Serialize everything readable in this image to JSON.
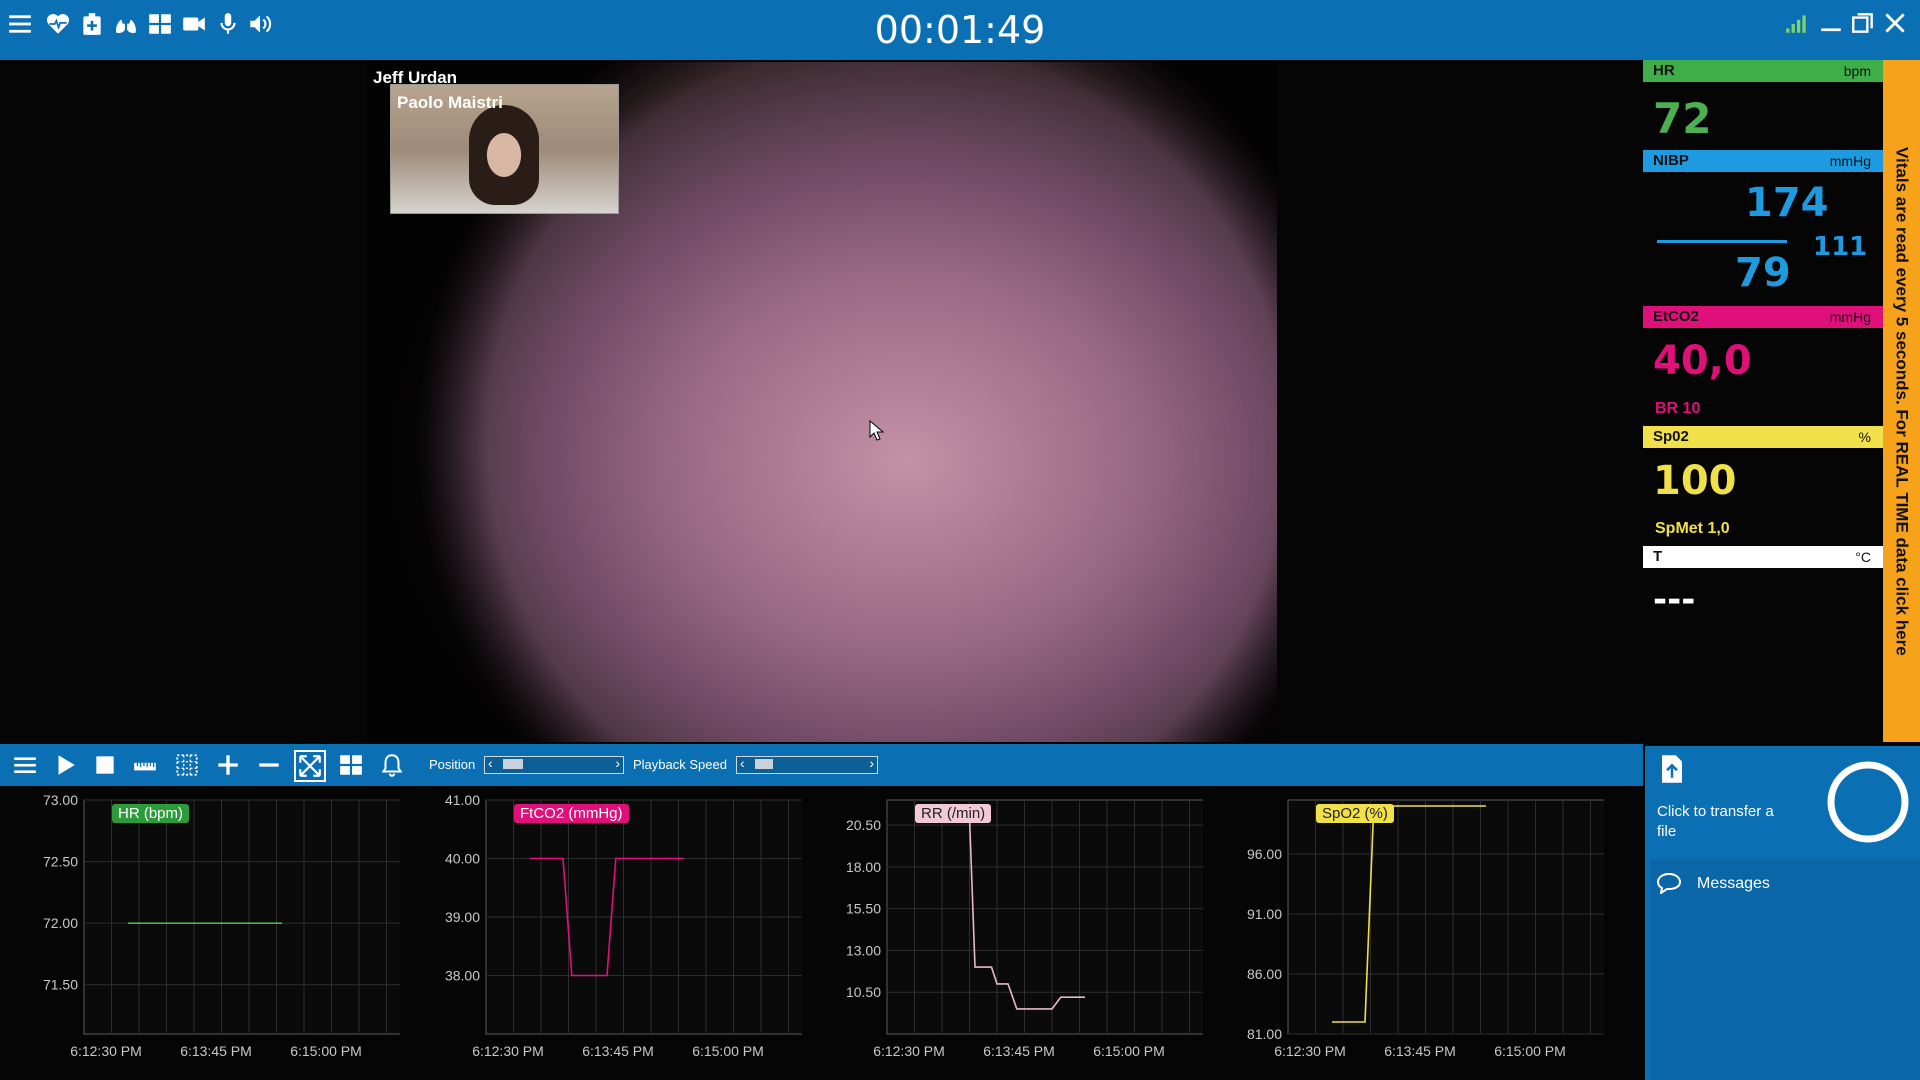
{
  "timer": "00:01:49",
  "video": {
    "caller_name": "Jeff Urdan",
    "pip_name": "Paolo Maistri"
  },
  "vitals": {
    "hr": {
      "label": "HR",
      "unit": "bpm",
      "value": "72",
      "color": "#4caf50"
    },
    "nibp": {
      "label": "NIBP",
      "unit": "mmHg",
      "systolic": "174",
      "mean": "111",
      "diastolic": "79",
      "color": "#1e9be0"
    },
    "etco2": {
      "label": "EtCO2",
      "unit": "mmHg",
      "value": "40,0",
      "sub": "BR 10",
      "color": "#e0107a"
    },
    "spo2": {
      "label": "Sp02",
      "unit": "%",
      "value": "100",
      "sub": "SpMet 1,0",
      "color": "#f0e04a"
    },
    "temp": {
      "label": "T",
      "unit": "°C",
      "value": "---",
      "color": "#ffffff"
    },
    "side_notice": "Vitals are read every 5 seconds. For REAL TIME data click here"
  },
  "controls": {
    "position_label": "Position",
    "playback_label": "Playback Speed"
  },
  "right_panel": {
    "transfer_label": "Click to transfer a file",
    "messages_label": "Messages"
  },
  "chart_data": [
    {
      "type": "line",
      "title": "HR (bpm)",
      "color": "#4caf50",
      "title_bg": "#2e9b3a",
      "title_fg": "#ffffff",
      "ylim": [
        71.1,
        73.0
      ],
      "yticks": [
        "73.00",
        "72.50",
        "72.00",
        "71.50"
      ],
      "ytick_values": [
        73.0,
        72.5,
        72.0,
        71.5
      ],
      "xlim": [
        0,
        3
      ],
      "xticks": [
        "6:12:30 PM",
        "6:13:45 PM",
        "6:15:00 PM"
      ],
      "xtick_values": [
        0.2,
        1.2,
        2.2
      ],
      "points": [
        [
          0.4,
          72.0
        ],
        [
          1.8,
          72.0
        ]
      ]
    },
    {
      "type": "line",
      "title": "FtCO2 (mmHg)",
      "color": "#e0107a",
      "title_bg": "#e0107a",
      "title_fg": "#ffffff",
      "ylim": [
        37.0,
        41.0
      ],
      "yticks": [
        "41.00",
        "40.00",
        "39.00",
        "38.00"
      ],
      "ytick_values": [
        41.0,
        40.0,
        39.0,
        38.0
      ],
      "xlim": [
        0,
        3
      ],
      "xticks": [
        "6:12:30 PM",
        "6:13:45 PM",
        "6:15:00 PM"
      ],
      "xtick_values": [
        0.2,
        1.2,
        2.2
      ],
      "points": [
        [
          0.4,
          40.0
        ],
        [
          0.7,
          40.0
        ],
        [
          0.78,
          38.0
        ],
        [
          1.1,
          38.0
        ],
        [
          1.18,
          40.0
        ],
        [
          1.8,
          40.0
        ]
      ]
    },
    {
      "type": "line",
      "title": "RR (/min)",
      "color": "#e6b8c8",
      "title_bg": "#f2c9d6",
      "title_fg": "#222222",
      "ylim": [
        8.0,
        22.0
      ],
      "yticks": [
        "20.50",
        "18.00",
        "15.50",
        "13.00",
        "10.50"
      ],
      "ytick_values": [
        20.5,
        18.0,
        15.5,
        13.0,
        10.5
      ],
      "xlim": [
        0,
        3
      ],
      "xticks": [
        "6:12:30 PM",
        "6:13:45 PM",
        "6:15:00 PM"
      ],
      "xtick_values": [
        0.2,
        1.2,
        2.2
      ],
      "points": [
        [
          0.75,
          21.0
        ],
        [
          0.8,
          12.0
        ],
        [
          0.95,
          12.0
        ],
        [
          1.0,
          11.0
        ],
        [
          1.1,
          11.0
        ],
        [
          1.18,
          9.5
        ],
        [
          1.5,
          9.5
        ],
        [
          1.58,
          10.2
        ],
        [
          1.8,
          10.2
        ]
      ]
    },
    {
      "type": "line",
      "title": "SpO2 (%)",
      "color": "#f0e04a",
      "title_bg": "#f0e04a",
      "title_fg": "#222222",
      "ylim": [
        81.0,
        100.5
      ],
      "yticks": [
        "96.00",
        "91.00",
        "86.00",
        "81.00"
      ],
      "ytick_values": [
        96.0,
        91.0,
        86.0,
        81.0
      ],
      "xlim": [
        0,
        3
      ],
      "xticks": [
        "6:12:30 PM",
        "6:13:45 PM",
        "6:15:00 PM"
      ],
      "xtick_values": [
        0.2,
        1.2,
        2.2
      ],
      "points": [
        [
          0.4,
          82.0
        ],
        [
          0.7,
          82.0
        ],
        [
          0.78,
          100.0
        ],
        [
          1.8,
          100.0
        ]
      ]
    }
  ]
}
